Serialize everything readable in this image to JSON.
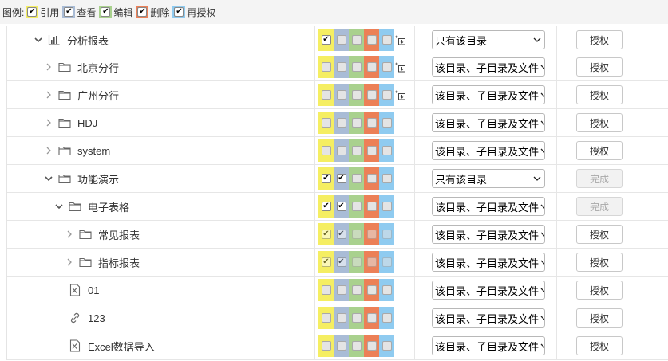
{
  "colors": {
    "cite": "#f5ee62",
    "view": "#a9bcd6",
    "edit": "#a9d18e",
    "delete": "#ec8057",
    "regrant": "#8fcbf0"
  },
  "legend": {
    "title": "图例:",
    "items": [
      {
        "key": "cite",
        "label": "引用"
      },
      {
        "key": "view",
        "label": "查看"
      },
      {
        "key": "edit",
        "label": "编辑"
      },
      {
        "key": "delete",
        "label": "删除"
      },
      {
        "key": "regrant",
        "label": "再授权"
      }
    ]
  },
  "rows": [
    {
      "name": "分析报表",
      "indent": 0,
      "chevron": "down",
      "icon": "chart-icon",
      "perms": {
        "cite": true,
        "view": false,
        "edit": false,
        "delete": false,
        "regrant": false
      },
      "permState": "normal",
      "inherit": true,
      "scope": "只有该目录",
      "action": "授权",
      "actionDisabled": false
    },
    {
      "name": "北京分行",
      "indent": 1,
      "chevron": "right",
      "icon": "folder-icon",
      "perms": {
        "cite": false,
        "view": false,
        "edit": false,
        "delete": false,
        "regrant": false
      },
      "permState": "normal",
      "inherit": true,
      "scope": "该目录、子目录及文件",
      "action": "授权",
      "actionDisabled": false
    },
    {
      "name": "广州分行",
      "indent": 1,
      "chevron": "right",
      "icon": "folder-icon",
      "perms": {
        "cite": false,
        "view": false,
        "edit": false,
        "delete": false,
        "regrant": false
      },
      "permState": "normal",
      "inherit": true,
      "scope": "该目录、子目录及文件",
      "action": "授权",
      "actionDisabled": false
    },
    {
      "name": "HDJ",
      "indent": 1,
      "chevron": "right",
      "icon": "folder-icon",
      "perms": {
        "cite": false,
        "view": false,
        "edit": false,
        "delete": false,
        "regrant": false
      },
      "permState": "normal",
      "inherit": false,
      "scope": "该目录、子目录及文件",
      "action": "授权",
      "actionDisabled": false
    },
    {
      "name": "system",
      "indent": 1,
      "chevron": "right",
      "icon": "folder-icon",
      "perms": {
        "cite": false,
        "view": false,
        "edit": false,
        "delete": false,
        "regrant": false
      },
      "permState": "normal",
      "inherit": false,
      "scope": "该目录、子目录及文件",
      "action": "授权",
      "actionDisabled": false
    },
    {
      "name": "功能演示",
      "indent": 1,
      "chevron": "down",
      "icon": "folder-icon",
      "perms": {
        "cite": true,
        "view": true,
        "edit": false,
        "delete": false,
        "regrant": false
      },
      "permState": "normal",
      "inherit": false,
      "scope": "只有该目录",
      "action": "完成",
      "actionDisabled": true
    },
    {
      "name": "电子表格",
      "indent": 2,
      "chevron": "down",
      "icon": "folder-icon",
      "perms": {
        "cite": true,
        "view": true,
        "edit": false,
        "delete": false,
        "regrant": false
      },
      "permState": "normal",
      "inherit": false,
      "scope": "该目录、子目录及文件",
      "action": "完成",
      "actionDisabled": true
    },
    {
      "name": "常见报表",
      "indent": 3,
      "chevron": "right",
      "icon": "folder-icon",
      "perms": {
        "cite": true,
        "view": true,
        "edit": false,
        "delete": false,
        "regrant": false
      },
      "permState": "disabled",
      "inherit": false,
      "scope": "该目录、子目录及文件",
      "action": "授权",
      "actionDisabled": false
    },
    {
      "name": "指标报表",
      "indent": 3,
      "chevron": "right",
      "icon": "folder-icon",
      "perms": {
        "cite": true,
        "view": true,
        "edit": false,
        "delete": false,
        "regrant": false
      },
      "permState": "disabled",
      "inherit": false,
      "scope": "该目录、子目录及文件",
      "action": "授权",
      "actionDisabled": false
    },
    {
      "name": "01",
      "indent": 2,
      "chevron": "none",
      "icon": "excel-file-icon",
      "perms": {
        "cite": false,
        "view": false,
        "edit": false,
        "delete": false,
        "regrant": false
      },
      "permState": "normal",
      "inherit": false,
      "scope": "该目录、子目录及文件",
      "action": "授权",
      "actionDisabled": false
    },
    {
      "name": "123",
      "indent": 2,
      "chevron": "none",
      "icon": "link-icon",
      "perms": {
        "cite": false,
        "view": false,
        "edit": false,
        "delete": false,
        "regrant": false
      },
      "permState": "normal",
      "inherit": false,
      "scope": "该目录、子目录及文件",
      "action": "授权",
      "actionDisabled": false
    },
    {
      "name": "Excel数据导入",
      "indent": 2,
      "chevron": "none",
      "icon": "excel-file-icon",
      "perms": {
        "cite": false,
        "view": false,
        "edit": false,
        "delete": false,
        "regrant": false
      },
      "permState": "normal",
      "inherit": false,
      "scope": "该目录、子目录及文件",
      "action": "授权",
      "actionDisabled": false
    }
  ]
}
